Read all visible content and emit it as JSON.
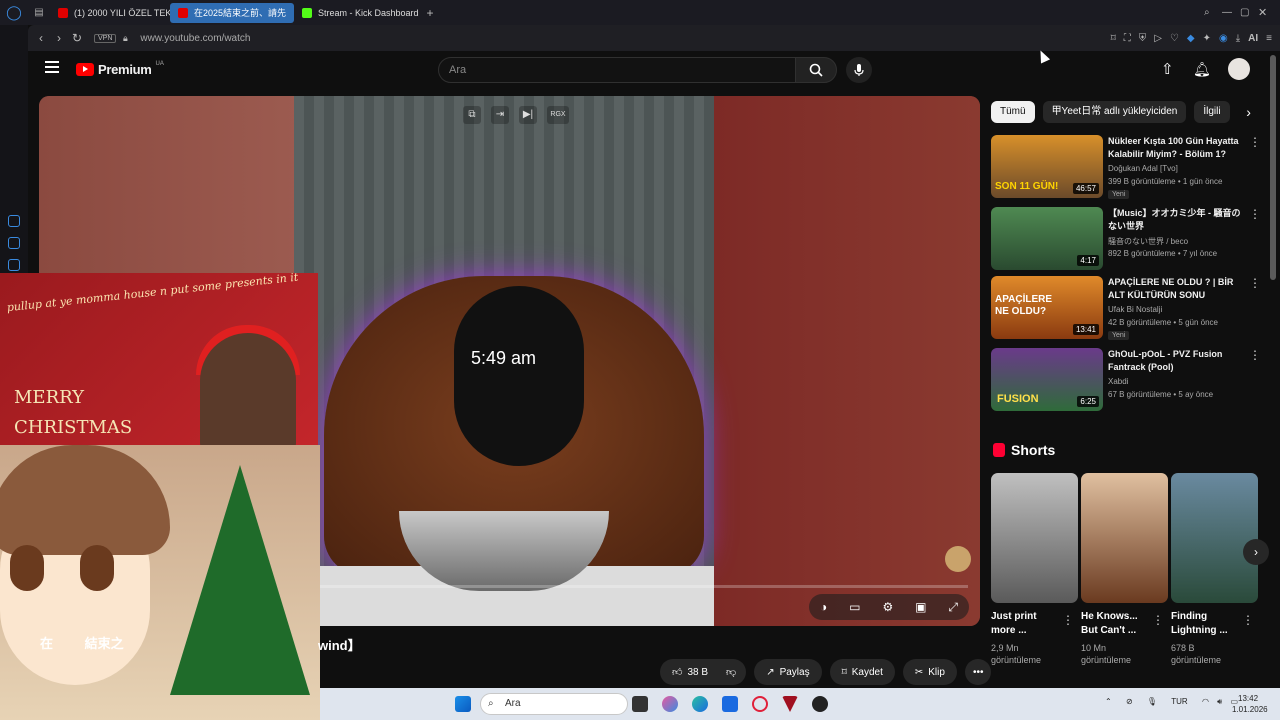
{
  "browser": {
    "tabs": [
      {
        "label": "(1) 2000 YILI ÖZEL TEKIN",
        "favicon_color": "#e00000",
        "active": false
      },
      {
        "label": "在2025結束之前、請先",
        "favicon_color": "#e00000",
        "active": true
      },
      {
        "label": "Stream - Kick Dashboard",
        "favicon_color": "#53fc18",
        "active": false
      }
    ],
    "new_tab": "+",
    "vpn_badge": "VPN",
    "url": "www.youtube.com/watch",
    "ai_label": "AI"
  },
  "youtube": {
    "logo_text": "Premium",
    "region": "UA",
    "search_placeholder": "Ara",
    "video": {
      "overlay_time": "5:49 am",
      "top_controls": [
        "⧉",
        "⇥",
        "▶|",
        "RGX"
      ],
      "title_partial_left": "在",
      "title_partial_mid": "結束之",
      "title_partial_right": "wind】"
    },
    "actions": {
      "likes": "38 B",
      "share": "Paylaş",
      "save": "Kaydet",
      "clip": "Klip",
      "more": "•••"
    },
    "chips": [
      "Tümü",
      "甲Yeet日常 adlı yükleyiciden",
      "İlgili"
    ],
    "recommendations": [
      {
        "title": "Nükleer Kışta 100 Gün Hayatta Kalabilir Miyim? - Bölüm 1?",
        "channel": "Doğukan Adal [Tvo]",
        "meta": "399 B görüntüleme • 1 gün önce",
        "badge": "Yeni",
        "duration": "46:57",
        "thumb_text": "SON 11 GÜN!",
        "thumb_color": "#6b4a2a"
      },
      {
        "title": "【Music】オオカミ少年 - 騒音のない世界",
        "channel": "騒音のない世界 / beco",
        "meta": "892 B görüntüleme • 7 yıl önce",
        "badge": "",
        "duration": "4:17",
        "thumb_text": "",
        "thumb_color": "#3f6b45"
      },
      {
        "title": "APAÇİLERE NE OLDU ? | BİR ALT KÜLTÜRÜN SONU",
        "channel": "Ufak Bi Nostalji",
        "meta": "42 B görüntüleme • 5 gün önce",
        "badge": "Yeni",
        "duration": "13:41",
        "thumb_text": "APAÇİLERE NE OLDU?",
        "thumb_color": "#b8661e"
      },
      {
        "title": "GhOuL-pOoL - PVZ Fusion Fantrack (Pool)",
        "channel": "Xabdi",
        "meta": "67 B görüntüleme • 5 ay önce",
        "badge": "",
        "duration": "6:25",
        "thumb_text": "FUSION",
        "thumb_color": "#2f6b3a"
      }
    ],
    "shorts_title": "Shorts",
    "shorts": [
      {
        "title": "Just print more ...",
        "views": "2,9 Mn görüntüleme",
        "thumb_color": "#8a8a8a"
      },
      {
        "title": "He Knows... But Can't ...",
        "views": "10 Mn görüntüleme",
        "thumb_color": "#7a4a2a"
      },
      {
        "title": "Finding Lightning ...",
        "views": "678 B görüntüleme",
        "thumb_color": "#3a5a6a"
      }
    ]
  },
  "overlays": {
    "christmas_line": "pullup at ye momma house n put some presents in it",
    "merry": "MERRY",
    "christmas": "CHRISTMAS"
  },
  "taskbar": {
    "search_placeholder": "Ara",
    "lang": "TUR",
    "time": "13:42",
    "date": "1.01.2026"
  }
}
